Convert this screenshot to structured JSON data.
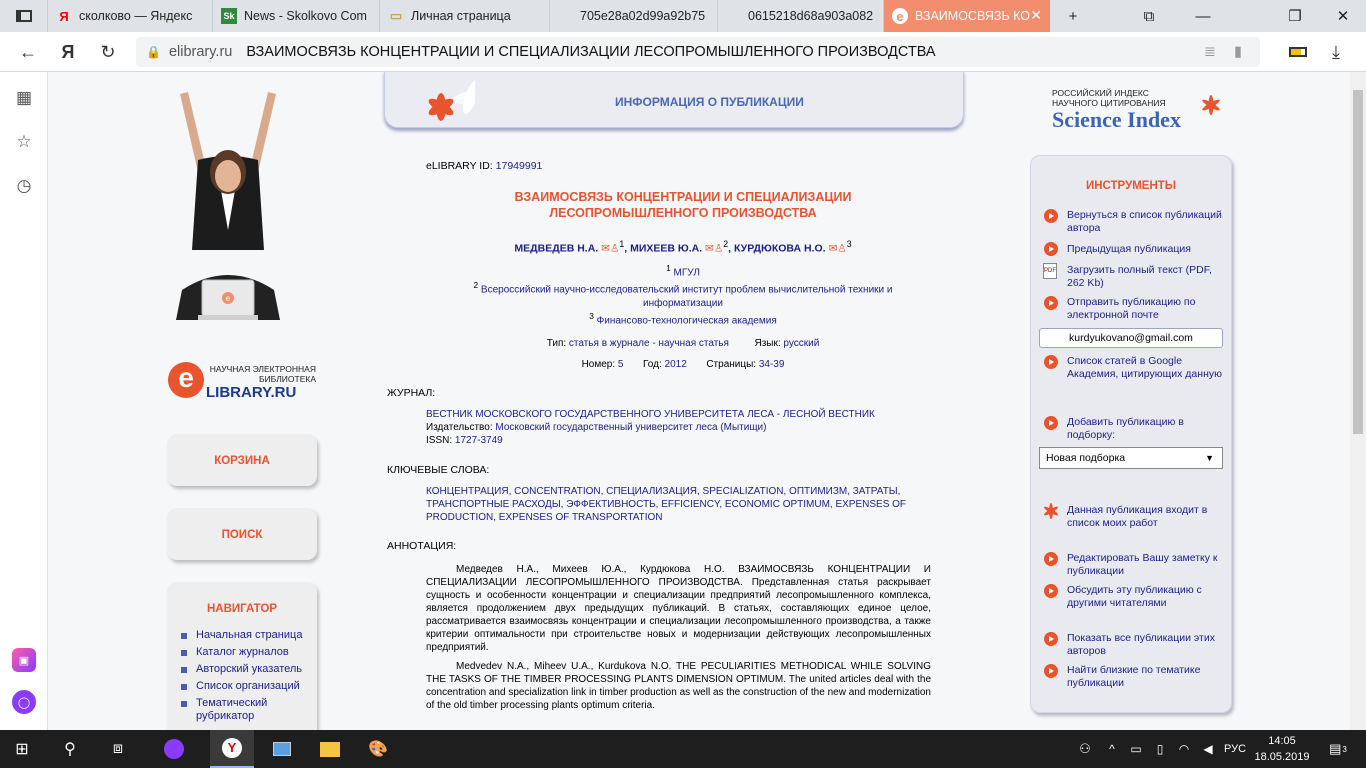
{
  "browser": {
    "tabs": [
      {
        "label": "",
        "icon": "tabs-icon"
      },
      {
        "label": "сколково — Яндекс",
        "icon": "yandex-icon",
        "favtext": "Я"
      },
      {
        "label": "News - Skolkovo Com",
        "icon": "skolkovo-icon",
        "favtext": "Sk"
      },
      {
        "label": "Личная страница",
        "icon": "page-icon",
        "favtext": "▭"
      },
      {
        "label": "705e28a02d99a92b75",
        "icon": "blank-icon",
        "favtext": ""
      },
      {
        "label": "0615218d68a903a082",
        "icon": "blank-icon",
        "favtext": ""
      },
      {
        "label": "ВЗАИМОСВЯЗЬ КО",
        "icon": "elibrary-icon",
        "favtext": "e"
      }
    ],
    "new_tab": "+",
    "url_domain": "elibrary.ru",
    "url_title": "ВЗАИМОСВЯЗЬ КОНЦЕНТРАЦИИ И СПЕЦИАЛИЗАЦИИ ЛЕСОПРОМЫШЛЕННОГО ПРОИЗВОДСТВА",
    "colors": {
      "active_tab": "#f28e6e",
      "tab_strip": "#dfe3e8",
      "taskbar": "#1e1e1e"
    }
  },
  "left": {
    "logo_line1": "НАУЧНАЯ ЭЛЕКТРОННАЯ",
    "logo_line2": "БИБЛИОТЕКА",
    "logo_main": "LIBRARY.RU",
    "logo_e": "e",
    "cart_label": "КОРЗИНА",
    "search_label": "ПОИСК",
    "navigator_title": "НАВИГАТОР",
    "nav_items": [
      "Начальная страница",
      "Каталог журналов",
      "Авторский указатель",
      "Список организаций",
      "Тематический рубрикатор"
    ]
  },
  "publication": {
    "header": "ИНФОРМАЦИЯ О ПУБЛИКАЦИИ",
    "id_label": "eLIBRARY ID:",
    "id_value": "17949991",
    "title_line1": "ВЗАИМОСВЯЗЬ КОНЦЕНТРАЦИИ И СПЕЦИАЛИЗАЦИИ",
    "title_line2": "ЛЕСОПРОМЫШЛЕННОГО ПРОИЗВОДСТВА",
    "authors": [
      {
        "name": "МЕДВЕДЕВ Н.А.",
        "sup": "1"
      },
      {
        "name": "МИХЕЕВ Ю.А.",
        "sup": "2"
      },
      {
        "name": "КУРДЮКОВА Н.О.",
        "sup": "3"
      }
    ],
    "affiliations": [
      {
        "sup": "1",
        "line1": "МГУЛ",
        "line2": ""
      },
      {
        "sup": "2",
        "line1": "Всероссийский научно-исследовательский институт проблем вычислительной техники и",
        "line2": "информатизации"
      },
      {
        "sup": "3",
        "line1": "Финансово-технологическая академия",
        "line2": ""
      }
    ],
    "type_label": "Тип:",
    "type_value": "статья в журнале - научная статья",
    "lang_label": "Язык:",
    "lang_value": "русский",
    "number_label": "Номер:",
    "number_value": "5",
    "year_label": "Год:",
    "year_value": "2012",
    "pages_label": "Страницы:",
    "pages_value": "34-39",
    "journal_section": "ЖУРНАЛ:",
    "journal_name": "ВЕСТНИК МОСКОВСКОГО ГОСУДАРСТВЕННОГО УНИВЕРСИТЕТА ЛЕСА - ЛЕСНОЙ ВЕСТНИК",
    "publisher_label": "Издательство:",
    "publisher_value": "Московский государственный университет леса (Мытищи)",
    "issn_label": "ISSN:",
    "issn_value": "1727-3749",
    "keywords_section": "КЛЮЧЕВЫЕ СЛОВА:",
    "keywords_line1": "КОНЦЕНТРАЦИЯ, CONCENTRATION, СПЕЦИАЛИЗАЦИЯ, SPECIALIZATION, ОПТИМИЗМ, ЗАТРАТЫ,",
    "keywords_line2": "ТРАНСПОРТНЫЕ РАСХОДЫ, ЭФФЕКТИВНОСТЬ, EFFICIENCY, ECONOMIC OPTIMUM, EXPENSES OF",
    "keywords_line3": "PRODUCTION, EXPENSES OF TRANSPORTATION",
    "abstract_section": "АННОТАЦИЯ:",
    "abstract_ru": "Медведев Н.А., Михеев Ю.А., Курдюкова Н.О. ВЗАИМОСВЯЗЬ КОНЦЕНТРАЦИИ И СПЕЦИАЛИЗАЦИИ ЛЕСОПРОМЫШЛЕННОГО ПРОИЗВОДСТВА. Представленная статья раскрывает сущность и особенности концентрации и специализации предприятий лесопромышленного комплекса, является продолжением двух предыдущих публикаций. В статьях, составляющих единое целое, рассматривается взаимосвязь концентрации и специализации лесопромышленного производства, а также критерии оптимальности при строительстве новых и модернизации действующих лесопромышленных предприятий.",
    "abstract_en": "Medvedev N.A., Miheev U.A., Kurdukova N.O. THE PECULIARITIES METHODICAL WHILE SOLVING THE TASKS OF THE TIMBER PROCESSING PLANTS DIMENSION OPTIMUM. The united articles deal with the concentration and specialization link in timber production as well as the construction of the new and modernization of the old timber processing plants optimum criteria."
  },
  "right": {
    "si_line1": "РОССИЙСКИЙ ИНДЕКС",
    "si_line2": "НАУЧНОГО ЦИТИРОВАНИЯ",
    "si_main": "Science Index",
    "tools_title": "ИНСТРУМЕНТЫ",
    "t1": "Вернуться в список публикаций автора",
    "t2": "Предыдущая публикация",
    "t3": "Загрузить полный текст (PDF, 262 Kb)",
    "t4": "Отправить публикацию по электронной почте",
    "email": "kurdyukovano@gmail.com",
    "t5": "Список статей в Google Академия, цитирующих данную",
    "t6": "Добавить публикацию в подборку:",
    "select_value": "Новая подборка",
    "t7": "Данная публикация входит в список моих работ",
    "t8": "Редактировать Вашу заметку к публикации",
    "t9": "Обсудить эту публикацию с другими читателями",
    "t10": "Показать все публикации этих авторов",
    "t11": "Найти близкие по тематике публикации"
  },
  "taskbar": {
    "lang": "РУС",
    "time": "14:05",
    "date": "18.05.2019",
    "notif_count": "3"
  }
}
